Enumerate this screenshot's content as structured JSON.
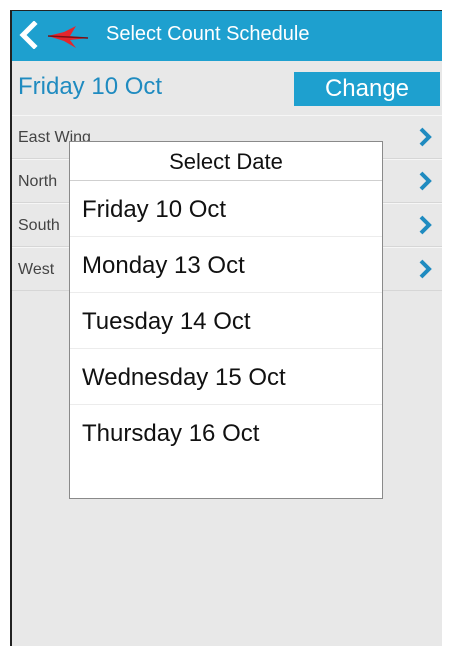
{
  "header": {
    "title": "Select Count Schedule",
    "back_icon": "chevron-left-icon",
    "logo_icon": "red-bird-logo",
    "background": "#1ea0cf"
  },
  "date_row": {
    "current_date": "Friday 10 Oct",
    "change_label": "Change"
  },
  "list": {
    "items": [
      {
        "label": "East Wing"
      },
      {
        "label": "North"
      },
      {
        "label": "South"
      },
      {
        "label": "West"
      }
    ],
    "chevron_icon": "chevron-right-icon",
    "accent": "#1f8bc0"
  },
  "dialog": {
    "title": "Select Date",
    "options": [
      {
        "label": "Friday 10 Oct"
      },
      {
        "label": "Monday 13 Oct"
      },
      {
        "label": "Tuesday 14 Oct"
      },
      {
        "label": "Wednesday 15 Oct"
      },
      {
        "label": "Thursday 16 Oct"
      }
    ]
  }
}
